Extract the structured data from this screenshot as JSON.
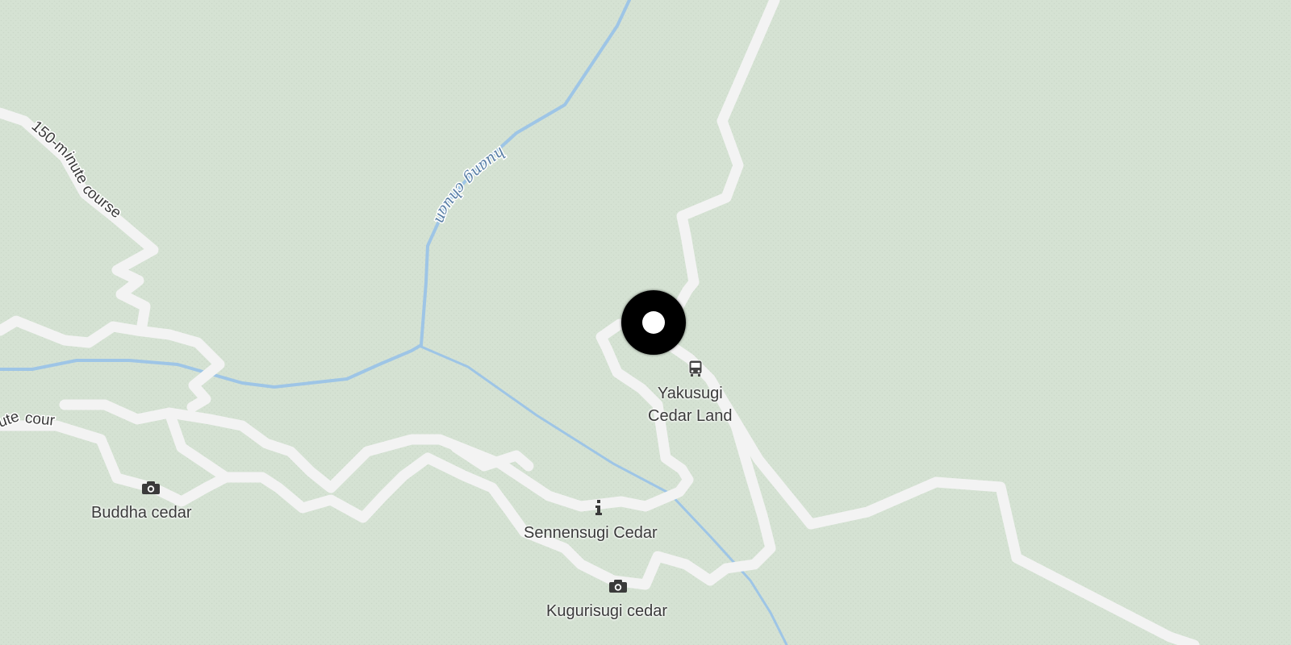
{
  "map": {
    "colors": {
      "land": "#d5e2d3",
      "trail": "#f3f3f3",
      "water": "#9ec5e6",
      "marker": "#000000",
      "text": "#3a3a3a",
      "water_text": "#5a7fa6"
    },
    "labels": {
      "yakusugi": "Yakusugi\nCedar Land",
      "sennensugi": "Sennensugi Cedar",
      "kugurisugi": "Kugurisugi cedar",
      "buddha": "Buddha cedar"
    },
    "route_labels": {
      "course150": "150-minute course",
      "course_partial": "ute course"
    },
    "water_labels": {
      "river": "huang chuan"
    },
    "icons": {
      "bus": "bus-stop-icon",
      "info": "info-icon",
      "camera": "camera-icon"
    },
    "marker": "location-marker"
  }
}
